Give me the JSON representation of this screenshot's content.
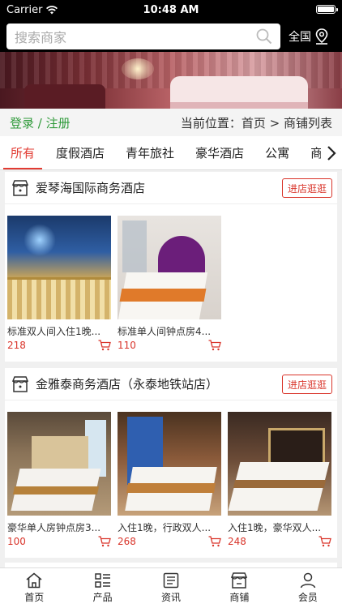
{
  "status_bar": {
    "carrier": "Carrier",
    "time": "10:48 AM"
  },
  "header": {
    "search_placeholder": "搜索商家",
    "region_label": "全国"
  },
  "location_bar": {
    "login_link": "登录 / 注册",
    "breadcrumb": "当前位置：首页 > 商铺列表"
  },
  "tabs": [
    {
      "label": "所有",
      "active": true
    },
    {
      "label": "度假酒店",
      "active": false
    },
    {
      "label": "青年旅社",
      "active": false
    },
    {
      "label": "豪华酒店",
      "active": false
    },
    {
      "label": "公寓",
      "active": false
    },
    {
      "label": "商",
      "active": false
    }
  ],
  "shops": [
    {
      "name": "爱琴海国际商务酒店",
      "visit_label": "进店逛逛",
      "products": [
        {
          "title": "标准双人间入住1晚...",
          "price": "218"
        },
        {
          "title": "标准单人间钟点房4...",
          "price": "110"
        }
      ]
    },
    {
      "name": "金雅泰商务酒店（永泰地铁站店）",
      "visit_label": "进店逛逛",
      "products": [
        {
          "title": "豪华单人房钟点房3...",
          "price": "100"
        },
        {
          "title": "入住1晚，行政双人...",
          "price": "268"
        },
        {
          "title": "入住1晚，豪华双人...",
          "price": "248"
        }
      ]
    }
  ],
  "bottom_nav": [
    {
      "label": "首页",
      "icon": "home-icon"
    },
    {
      "label": "产品",
      "icon": "list-icon"
    },
    {
      "label": "资讯",
      "icon": "news-icon"
    },
    {
      "label": "商铺",
      "icon": "shop-icon"
    },
    {
      "label": "会员",
      "icon": "user-icon"
    }
  ],
  "colors": {
    "accent": "#e23b32",
    "login": "#2f9a3a",
    "topbar": "#000000"
  }
}
